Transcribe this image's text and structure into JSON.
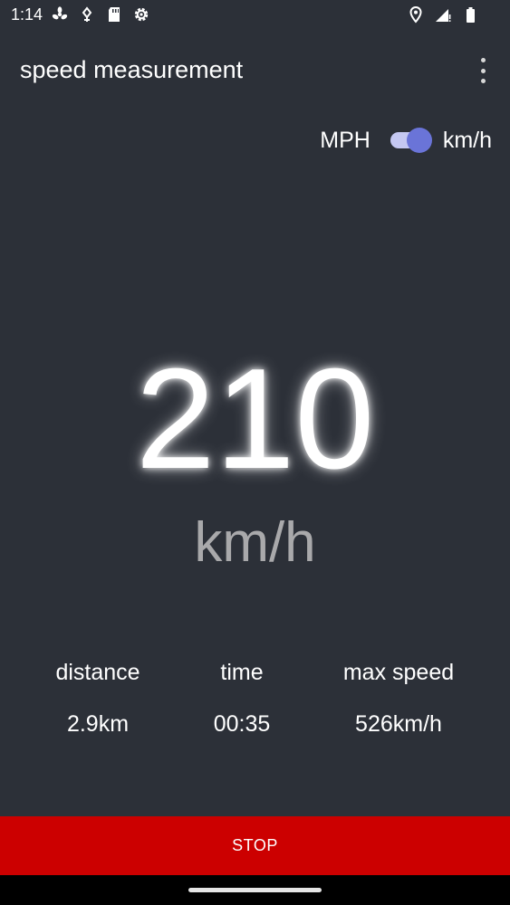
{
  "status_bar": {
    "time": "1:14",
    "left_icons": [
      "fan-icon",
      "pinwheel-icon",
      "sd-card-icon",
      "settings-gear-icon"
    ],
    "right_icons": [
      "location-icon",
      "signal-icon",
      "battery-icon"
    ]
  },
  "app_bar": {
    "title": "speed measurement",
    "menu_icon": "overflow-menu-icon"
  },
  "unit_toggle": {
    "left_label": "MPH",
    "right_label": "km/h",
    "checked": true,
    "colors": {
      "track": "#c5c8f2",
      "thumb": "#6a74d8"
    }
  },
  "speed": {
    "value": "210",
    "unit": "km/h"
  },
  "stats": {
    "distance": {
      "label": "distance",
      "value": "2.9km"
    },
    "time": {
      "label": "time",
      "value": "00:35"
    },
    "max_speed": {
      "label": "max speed",
      "value": "526km/h"
    }
  },
  "actions": {
    "stop_label": "STOP",
    "stop_color": "#cc0000"
  },
  "colors": {
    "background": "#2c3038",
    "text": "#ffffff",
    "muted_text": "#a9a9ab"
  }
}
